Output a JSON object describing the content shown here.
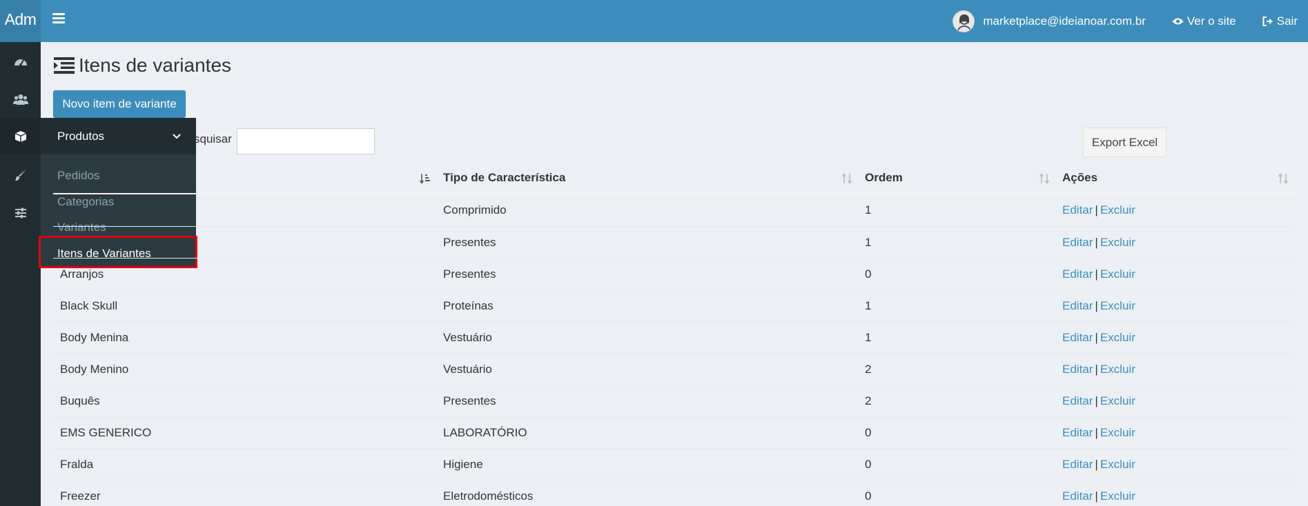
{
  "app": {
    "logo": "Adm"
  },
  "header": {
    "user_email": "marketplace@ideianoar.com.br",
    "view_site": "Ver o site",
    "logout": "Sair"
  },
  "sidebar": {
    "icons": [
      "dashboard-icon",
      "users-icon",
      "cube-icon",
      "paint-brush-icon",
      "sliders-icon"
    ],
    "flyout": {
      "title": "Produtos",
      "items": [
        {
          "label": "Pedidos"
        },
        {
          "label": "Categorias"
        },
        {
          "label": "Variantes"
        },
        {
          "label": "Itens de Variantes"
        }
      ]
    }
  },
  "page": {
    "title": "Itens de variantes",
    "new_button": "Novo item de variante",
    "search_label": "squisar",
    "search_value": "",
    "export_button": "Export Excel"
  },
  "table": {
    "headers": [
      "",
      "Tipo de Característica",
      "Ordem",
      "Ações"
    ],
    "edit_label": "Editar",
    "delete_label": "Excluir",
    "sep": "|",
    "rows": [
      {
        "name": "",
        "type": "Comprimido",
        "order": "1"
      },
      {
        "name": "",
        "type": "Presentes",
        "order": "1"
      },
      {
        "name": "Arranjos",
        "type": "Presentes",
        "order": "0"
      },
      {
        "name": "Black Skull",
        "type": "Proteínas",
        "order": "1"
      },
      {
        "name": "Body Menina",
        "type": "Vestuário",
        "order": "1"
      },
      {
        "name": "Body Menino",
        "type": "Vestuário",
        "order": "2"
      },
      {
        "name": "Buquês",
        "type": "Presentes",
        "order": "2"
      },
      {
        "name": "EMS GENERICO",
        "type": "LABORATÓRIO",
        "order": "0"
      },
      {
        "name": "Fralda",
        "type": "Higiene",
        "order": "0"
      },
      {
        "name": "Freezer",
        "type": "Eletrodomésticos",
        "order": "0"
      }
    ]
  },
  "colors": {
    "header": "#3c8dbc",
    "logo_bg": "#367fa9",
    "sidebar": "#222d32",
    "flyout": "#2c3b41",
    "highlight": "#e2000f",
    "content_bg": "#ecf0f5",
    "link": "#3c8dbc"
  }
}
